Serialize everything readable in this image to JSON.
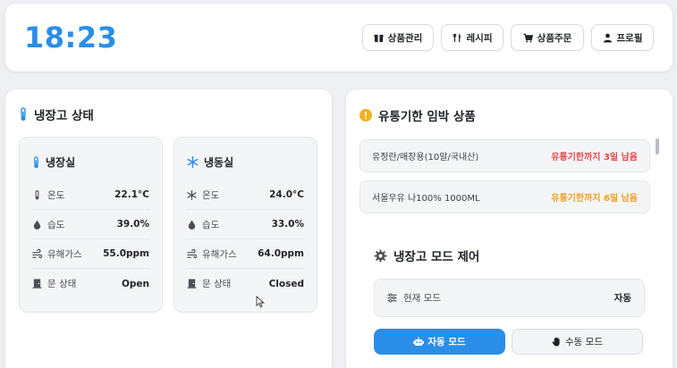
{
  "header": {
    "clock": "18:23",
    "nav": [
      {
        "label": "상품관리",
        "icon": "box-icon"
      },
      {
        "label": "레시피",
        "icon": "utensils-icon"
      },
      {
        "label": "상품주문",
        "icon": "cart-icon"
      },
      {
        "label": "프로필",
        "icon": "user-icon"
      }
    ]
  },
  "fridge": {
    "title": "냉장고 상태",
    "fridge_compartment": {
      "title": "냉장실",
      "rows": [
        {
          "label": "온도",
          "value": "22.1°C"
        },
        {
          "label": "습도",
          "value": "39.0%"
        },
        {
          "label": "유해가스",
          "value": "55.0ppm"
        },
        {
          "label": "문 상태",
          "value": "Open"
        }
      ]
    },
    "freezer_compartment": {
      "title": "냉동실",
      "rows": [
        {
          "label": "온도",
          "value": "24.0°C"
        },
        {
          "label": "습도",
          "value": "33.0%"
        },
        {
          "label": "유해가스",
          "value": "64.0ppm"
        },
        {
          "label": "문 상태",
          "value": "Closed"
        }
      ]
    }
  },
  "expiry": {
    "title": "유통기한 임박 상품",
    "items": [
      {
        "name": "유정란/매장용(10알/국내산)",
        "status": "유통기한까지 3일 남음",
        "color": "#e5484d"
      },
      {
        "name": "서울우유 나100% 1000ML",
        "status": "유통기한까지 6일 남음",
        "color": "#f0a020"
      }
    ]
  },
  "mode": {
    "title": "냉장고 모드 제어",
    "current_label": "현재 모드",
    "current_value": "자동",
    "auto_label": "자동 모드",
    "manual_label": "수동 모드"
  },
  "colors": {
    "accent": "#2a8ee8",
    "danger": "#e5484d",
    "warning": "#f0a020"
  }
}
